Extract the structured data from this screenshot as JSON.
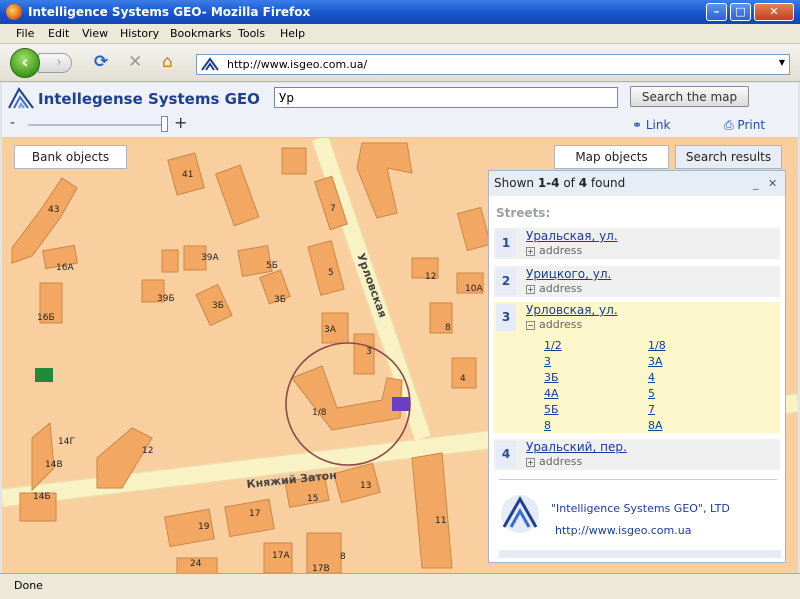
{
  "window": {
    "title": "Intelligence Systems GEO- Mozilla Firefox",
    "minimize": "–",
    "maximize": "□",
    "close": "✕"
  },
  "menu": [
    "File",
    "Edit",
    "View",
    "History",
    "Bookmarks",
    "Tools",
    "Help"
  ],
  "nav": {
    "back": "‹",
    "forward": "›",
    "reload": "⟳",
    "stop": "✕",
    "home": "⌂",
    "url": "http://www.isgeo.com.ua/"
  },
  "site": {
    "logo_text": "Intellegense Systems GEO",
    "search_value": "Ур",
    "search_button": "Search the map",
    "zoom_minus": "-",
    "zoom_plus": "+",
    "link_label": "Link",
    "print_label": "Print"
  },
  "tabs": {
    "bank": "Bank objects",
    "map": "Map objects",
    "results": "Search results"
  },
  "map": {
    "street_labels": [
      "Урловская",
      "Княжий Затон"
    ],
    "house_labels": [
      "41",
      "43",
      "7",
      "16А",
      "39А",
      "5Б",
      "5",
      "12",
      "3Б",
      "39Б",
      "3Б",
      "16Б",
      "10А",
      "3А",
      "8",
      "3",
      "4",
      "1/8",
      "14Г",
      "12",
      "14В",
      "13",
      "15",
      "14Б",
      "11",
      "17",
      "19",
      "17А",
      "24",
      "17В",
      "8"
    ]
  },
  "results": {
    "summary_prefix": "Shown ",
    "summary_range": "1-4",
    "summary_mid": " of ",
    "summary_total": "4",
    "summary_suffix": " found",
    "collapse": "_",
    "close": "✕",
    "streets_label": "Streets:",
    "address_label": "address",
    "items": [
      {
        "num": "1",
        "name": "Уральская, ул.",
        "expand": "+"
      },
      {
        "num": "2",
        "name": "Урицкого, ул.",
        "expand": "+"
      },
      {
        "num": "3",
        "name": "Урловская, ул.",
        "expand": "−"
      },
      {
        "num": "4",
        "name": "Уральский, пер.",
        "expand": "+"
      }
    ],
    "houses_col1": [
      "1/2",
      "3",
      "3Б",
      "4А",
      "5Б",
      "8"
    ],
    "houses_col2": [
      "1/8",
      "3А",
      "4",
      "5",
      "7",
      "8А"
    ],
    "footer_company": "\"Intelligence Systems GEO\", LTD",
    "footer_url": "http://www.isgeo.com.ua"
  },
  "status": "Done",
  "colors": {
    "map_bg": "#f9cfa0",
    "building": "#f2a863",
    "road": "#f8f2c4",
    "highlight": "#fcf6cb",
    "circle": "#8b4a4a"
  }
}
